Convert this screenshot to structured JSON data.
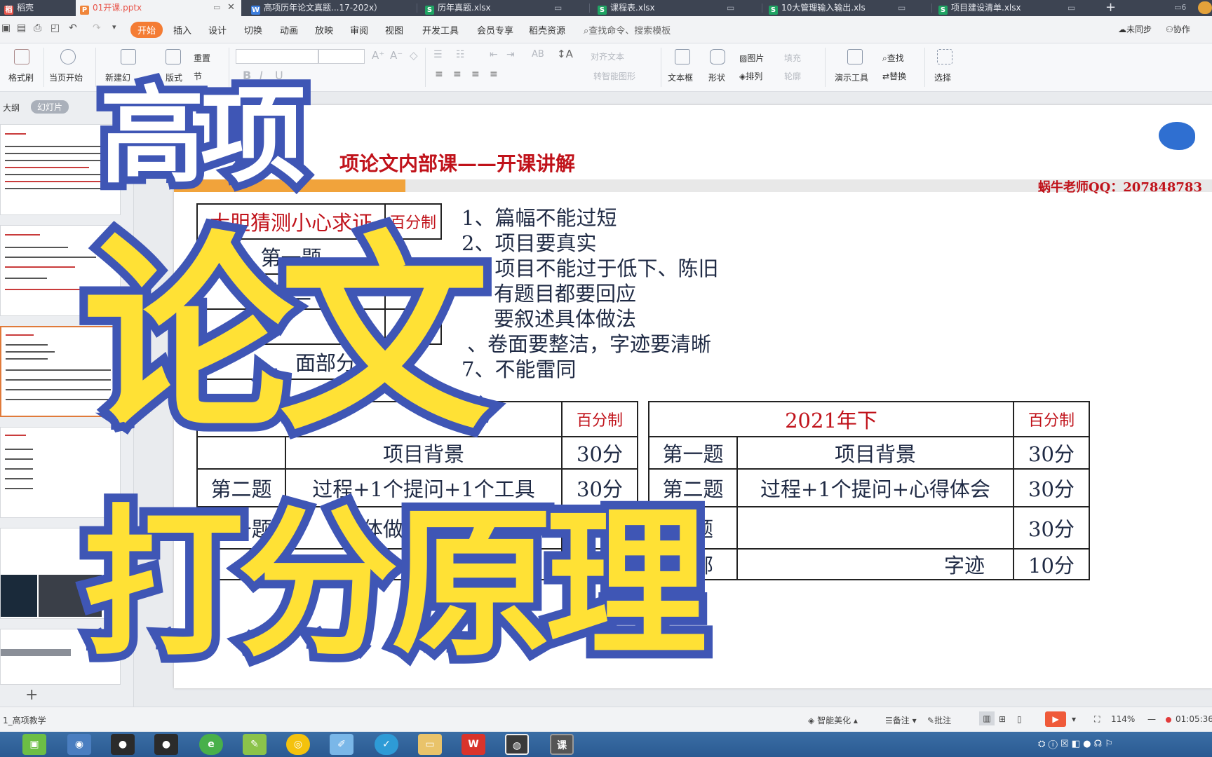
{
  "tabs": [
    {
      "label": "稻壳",
      "icon": "docer-icon",
      "color": "#e8554b"
    },
    {
      "label": "01开课.pptx",
      "icon": "ppt-icon",
      "color": "#f0853a"
    },
    {
      "label": "高项历年论文真题...17-202x）",
      "icon": "word-icon",
      "color": "#3b7ddd"
    },
    {
      "label": "历年真题.xlsx",
      "icon": "excel-icon",
      "color": "#1fa463"
    },
    {
      "label": "课程表.xlsx",
      "icon": "excel-icon",
      "color": "#1fa463"
    },
    {
      "label": "10大管理输入输出.xls",
      "icon": "excel-icon",
      "color": "#1fa463"
    },
    {
      "label": "项目建设清单.xlsx",
      "icon": "excel-icon",
      "color": "#1fa463"
    }
  ],
  "menu": {
    "items": [
      "开始",
      "插入",
      "设计",
      "切换",
      "动画",
      "放映",
      "审阅",
      "视图",
      "开发工具",
      "会员专享",
      "稻壳资源"
    ],
    "search_placeholder": "查找命令、搜索模板",
    "sync": "未同步",
    "collab": "协作"
  },
  "ribbon": {
    "format_painter": "格式刷",
    "from_current": "当页开始",
    "new_slide": "新建幻",
    "layout": "版式",
    "reset": "重置",
    "section": "节",
    "textbox": "文本框",
    "shape": "形状",
    "picture": "图片",
    "arrange": "排列",
    "fill": "填充",
    "outline": "轮廓",
    "presenter": "演示工具",
    "find": "查找",
    "replace": "替换",
    "select": "选择",
    "align_text": "对齐文本",
    "smartart": "转智能图形"
  },
  "leftpanel": {
    "outline": "大纲",
    "slides": "幻灯片",
    "add": "+"
  },
  "slide": {
    "title": "项论文内部课——开课讲解",
    "teacher": "蜗牛老师QQ：207848783",
    "table1": {
      "header": [
        "大胆猜测小心求证",
        "百分制"
      ],
      "rows": [
        [
          "第一题",
          ""
        ],
        [
          "第二",
          ""
        ],
        [
          "题",
          "30"
        ],
        [
          "面部分",
          ""
        ]
      ]
    },
    "list": [
      "1、篇幅不能过短",
      "2、项目要真实",
      "3、项目不能过于低下、陈旧",
      "有题目都要回应",
      "要叙述具体做法",
      "、卷面要整洁，字迹要清晰",
      "7、不能雷同"
    ],
    "table2": {
      "header": [
        "",
        "百分制"
      ],
      "rows": [
        [
          "",
          "项目背景",
          "30分"
        ],
        [
          "第二题",
          "过程+1个提问+1个工具",
          "30分"
        ],
        [
          "第一题",
          "具体做法心得体会",
          ""
        ],
        [
          "",
          "否",
          "迹"
        ]
      ]
    },
    "table3": {
      "header": [
        "2021年下",
        "百分制"
      ],
      "rows": [
        [
          "第一题",
          "项目背景",
          "30分"
        ],
        [
          "第二题",
          "过程+1个提问+心得体会",
          "30分"
        ],
        [
          "三题",
          "",
          "30分"
        ],
        [
          "面部",
          "字迹",
          "10分"
        ]
      ]
    }
  },
  "overlay": {
    "line1": "高项",
    "line2": "论文",
    "line3": "打分原理"
  },
  "statusbar": {
    "slide_name": "1_高项教学",
    "beautify": "智能美化",
    "notes": "备注",
    "comment": "批注",
    "zoom": "114%",
    "time": "01:05:36"
  },
  "taskbar": {
    "icons": [
      "file-manager-icon",
      "browser-icon",
      "recorder-icon",
      "recorder-icon",
      "ie-icon",
      "notepad-icon",
      "chrome-icon",
      "paint-icon",
      "app-icon",
      "folder-icon",
      "wps-icon",
      "snail-icon",
      "ppt-taskbar-icon"
    ]
  },
  "colors": {
    "accent": "#f47c34",
    "overlay_stroke": "#3f56b5",
    "overlay_yellow": "#ffe135",
    "red_text": "#c0121a"
  }
}
